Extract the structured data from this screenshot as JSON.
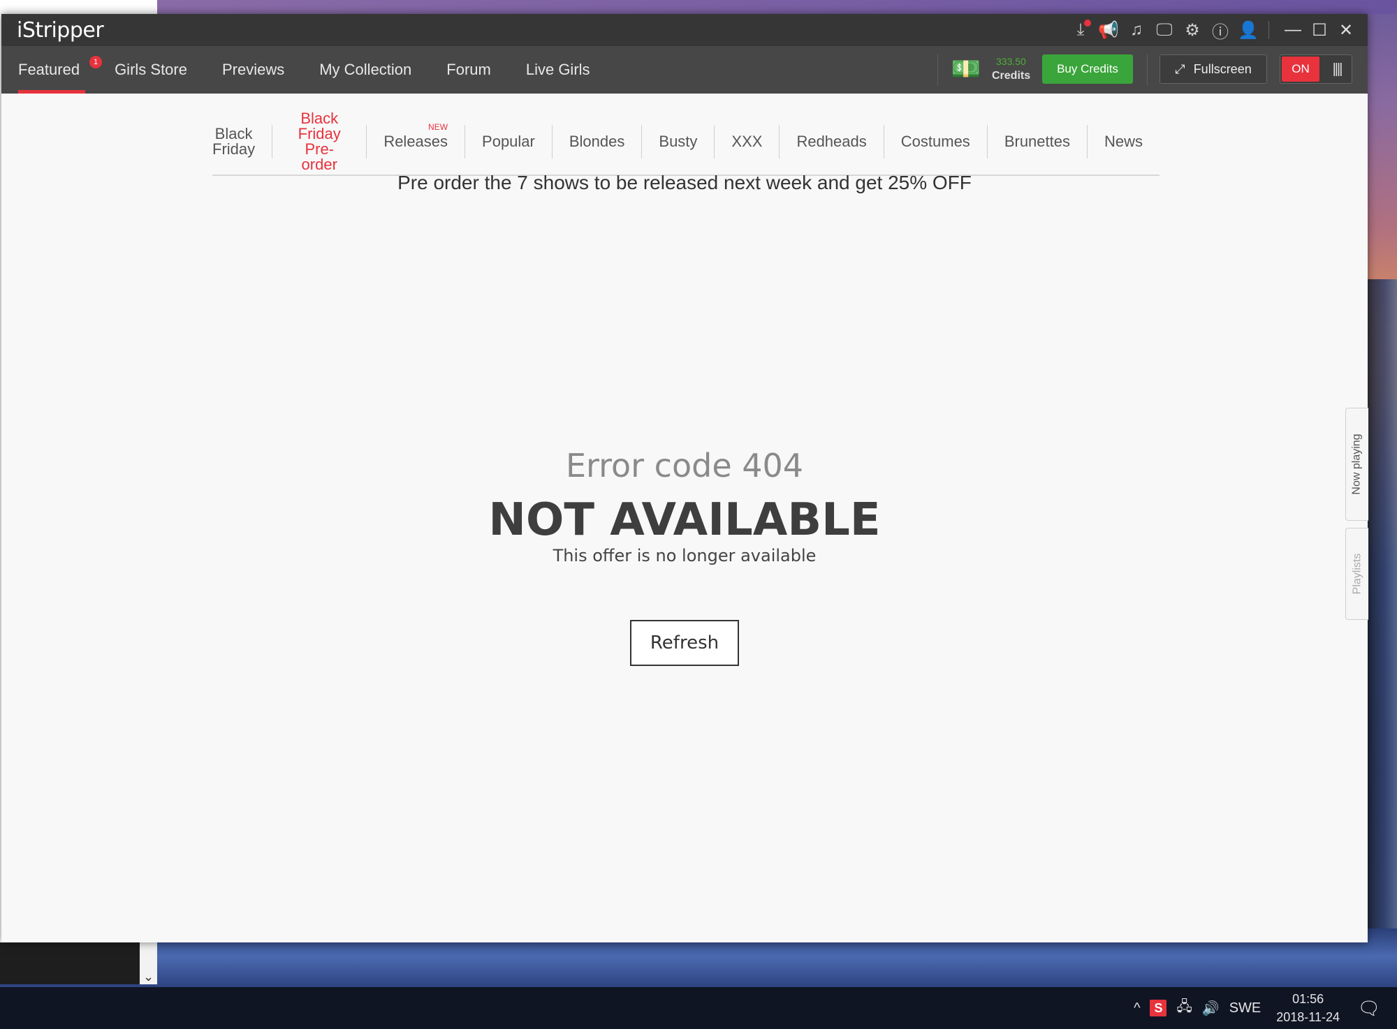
{
  "app": {
    "title": "iStripper"
  },
  "nav": {
    "tabs": [
      {
        "label": "Featured",
        "badge": "1"
      },
      {
        "label": "Girls Store"
      },
      {
        "label": "Previews"
      },
      {
        "label": "My Collection"
      },
      {
        "label": "Forum"
      },
      {
        "label": "Live Girls"
      }
    ],
    "credits_amount": "333.50",
    "credits_label": "Credits",
    "buy_credits": "Buy Credits",
    "fullscreen": "Fullscreen",
    "toggle_on": "ON"
  },
  "categories": [
    {
      "line1": "Black",
      "line2": "Friday"
    },
    {
      "line1": "Black Friday",
      "line2": "Pre-order"
    },
    {
      "line1": "Releases",
      "badge": "NEW"
    },
    {
      "line1": "Popular"
    },
    {
      "line1": "Blondes"
    },
    {
      "line1": "Busty"
    },
    {
      "line1": "XXX"
    },
    {
      "line1": "Redheads"
    },
    {
      "line1": "Costumes"
    },
    {
      "line1": "Brunettes"
    },
    {
      "line1": "News"
    }
  ],
  "promo": "Pre order the 7 shows to be released next week and get 25% OFF",
  "error": {
    "code": "Error code 404",
    "title": "NOT AVAILABLE",
    "message": "This offer is no longer available",
    "refresh": "Refresh"
  },
  "side_tabs": {
    "now_playing": "Now playing",
    "playlists": "Playlists"
  },
  "taskbar": {
    "language": "SWE",
    "time": "01:56",
    "date": "2018-11-24"
  },
  "colors": {
    "accent": "#e8323c",
    "green": "#3aa53a",
    "titlebar": "#363636",
    "navbar": "#474747"
  },
  "icons": [
    "download-icon",
    "announce-icon",
    "music-icon",
    "monitor-icon",
    "gear-icon",
    "info-icon",
    "user-icon",
    "minimize-icon",
    "maximize-icon",
    "close-icon",
    "money-icon",
    "expand-icon"
  ]
}
